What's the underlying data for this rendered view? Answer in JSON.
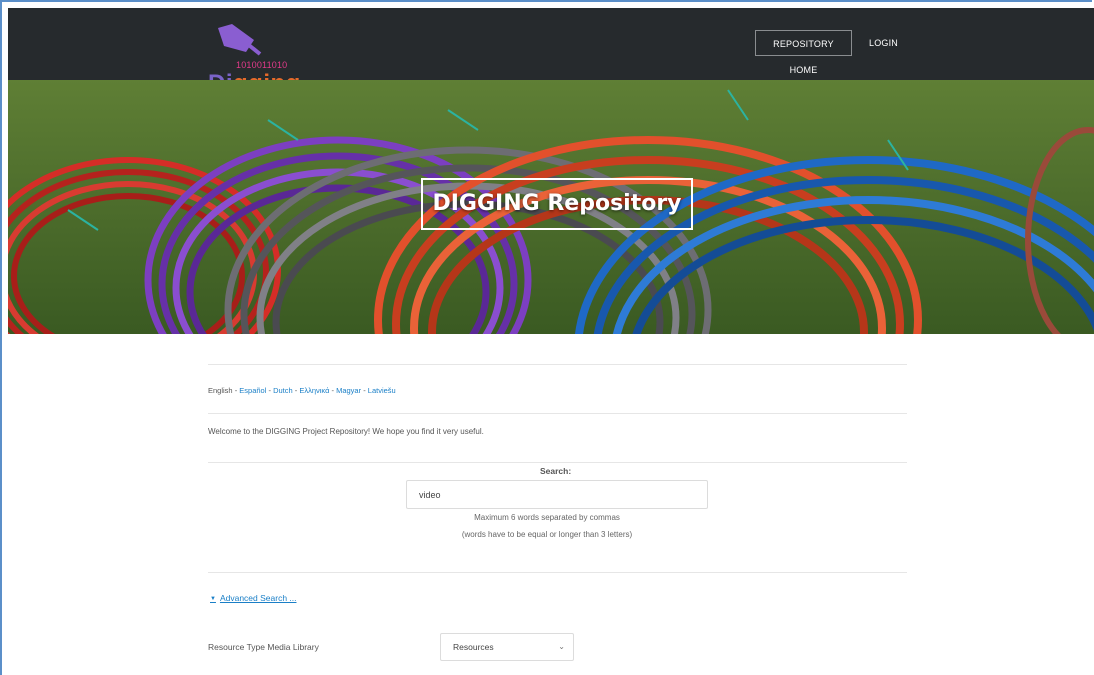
{
  "header": {
    "logo_digits": "1010011010",
    "logo_word_part1": "Di",
    "logo_word_part2": "gging",
    "nav": {
      "home": "REPOSITORY HOME",
      "login": "LOGIN"
    }
  },
  "hero": {
    "title": "DIGGING Repository"
  },
  "languages": {
    "current": "English",
    "separator": " - ",
    "others": [
      "Español",
      "Dutch",
      "Ελληνικά",
      "Magyar",
      "Latviešu"
    ]
  },
  "welcome": "Welcome to the DIGGING Project Repository! We hope you find it very useful.",
  "search": {
    "label": "Search:",
    "value": "video",
    "help_line1": "Maximum 6 words separated by commas",
    "help_line2": "(words have to be equal or longer than 3 letters)"
  },
  "advanced": {
    "label": "Advanced Search ...",
    "icon": "triangle-down-icon"
  },
  "resource_type": {
    "label": "Resource Type Media Library",
    "selected": "Resources",
    "icon": "chevron-down-icon"
  },
  "colors": {
    "navbar": "#262a2d",
    "link": "#1a7fc7",
    "logo_purple": "#7a63c8",
    "logo_orange": "#e56a2a",
    "logo_pink": "#e33a8a"
  }
}
